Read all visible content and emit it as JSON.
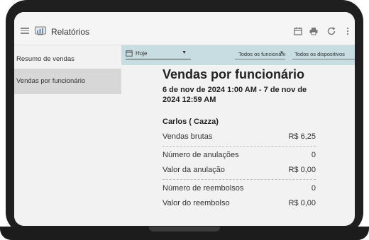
{
  "header": {
    "title": "Relatórios",
    "icons": [
      "menu-icon",
      "report-logo-icon",
      "calendar-icon",
      "print-icon",
      "refresh-icon",
      "more-vert-icon"
    ]
  },
  "sidebar": {
    "items": [
      {
        "label": "Resumo de vendas",
        "active": false
      },
      {
        "label": "Vendas por funcionário",
        "active": true
      }
    ]
  },
  "filters": {
    "date_range": "Hoje",
    "employees": "Todos os funcionários",
    "devices": "Todos os dispositivos"
  },
  "report": {
    "title": "Vendas por funcionário",
    "date_range": "6 de nov de 2024 1:00 AM - 7 de nov de 2024 12:59 AM",
    "employee": "Carlos ( Cazza)",
    "metrics": [
      {
        "label": "Vendas brutas",
        "value": "R$ 6,25"
      },
      {
        "label": "Número de anulações",
        "value": "0"
      },
      {
        "label": "Valor da anulação",
        "value": "R$ 0,00"
      },
      {
        "label": "Número de reembolsos",
        "value": "0"
      },
      {
        "label": "Valor do reembolso",
        "value": "R$ 0,00"
      }
    ]
  },
  "colors": {
    "accent_bar": "#c8dde1",
    "sidebar_active": "#d7d7d7",
    "background": "#f2f2f2",
    "frame": "#1f1f1f"
  }
}
